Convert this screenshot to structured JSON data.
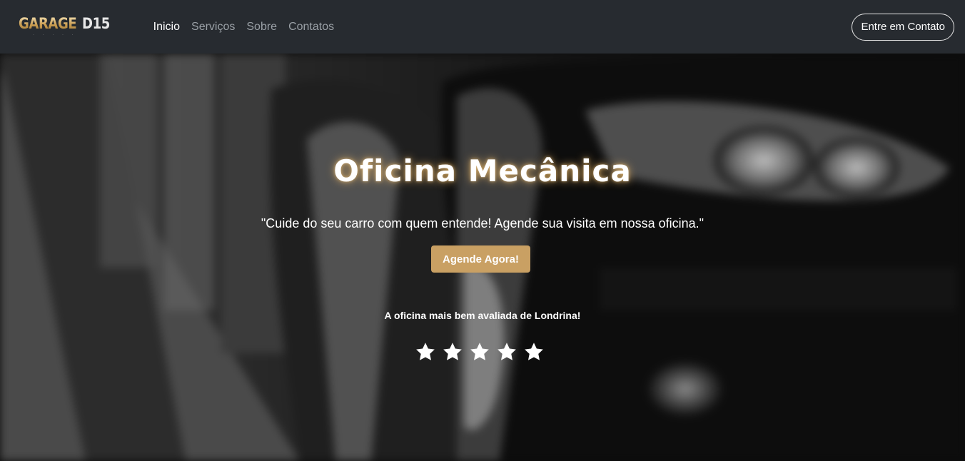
{
  "brand": {
    "logo_word": "GARAGE",
    "logo_mark": "D15",
    "logo_tagline": "· · · · ·"
  },
  "nav": {
    "links": [
      "Inicio",
      "Serviços",
      "Sobre",
      "Contatos"
    ],
    "active": "Inicio",
    "contact_button": "Entre em Contato"
  },
  "hero": {
    "title": "Oficina Mecânica",
    "quote": "\"Cuide do seu carro com quem entende! Agende sua visita em nossa oficina.\"",
    "cta_label": "Agende Agora!",
    "rating_text": "A oficina mais bem avaliada de Londrina!",
    "rating_stars": 5,
    "rating_max": 5
  },
  "colors": {
    "navbar": "#272b30",
    "accent_gold": "#c9a063",
    "star": "#ffffff"
  },
  "icons": {
    "rating": "star-icon",
    "background": "car-photo"
  }
}
